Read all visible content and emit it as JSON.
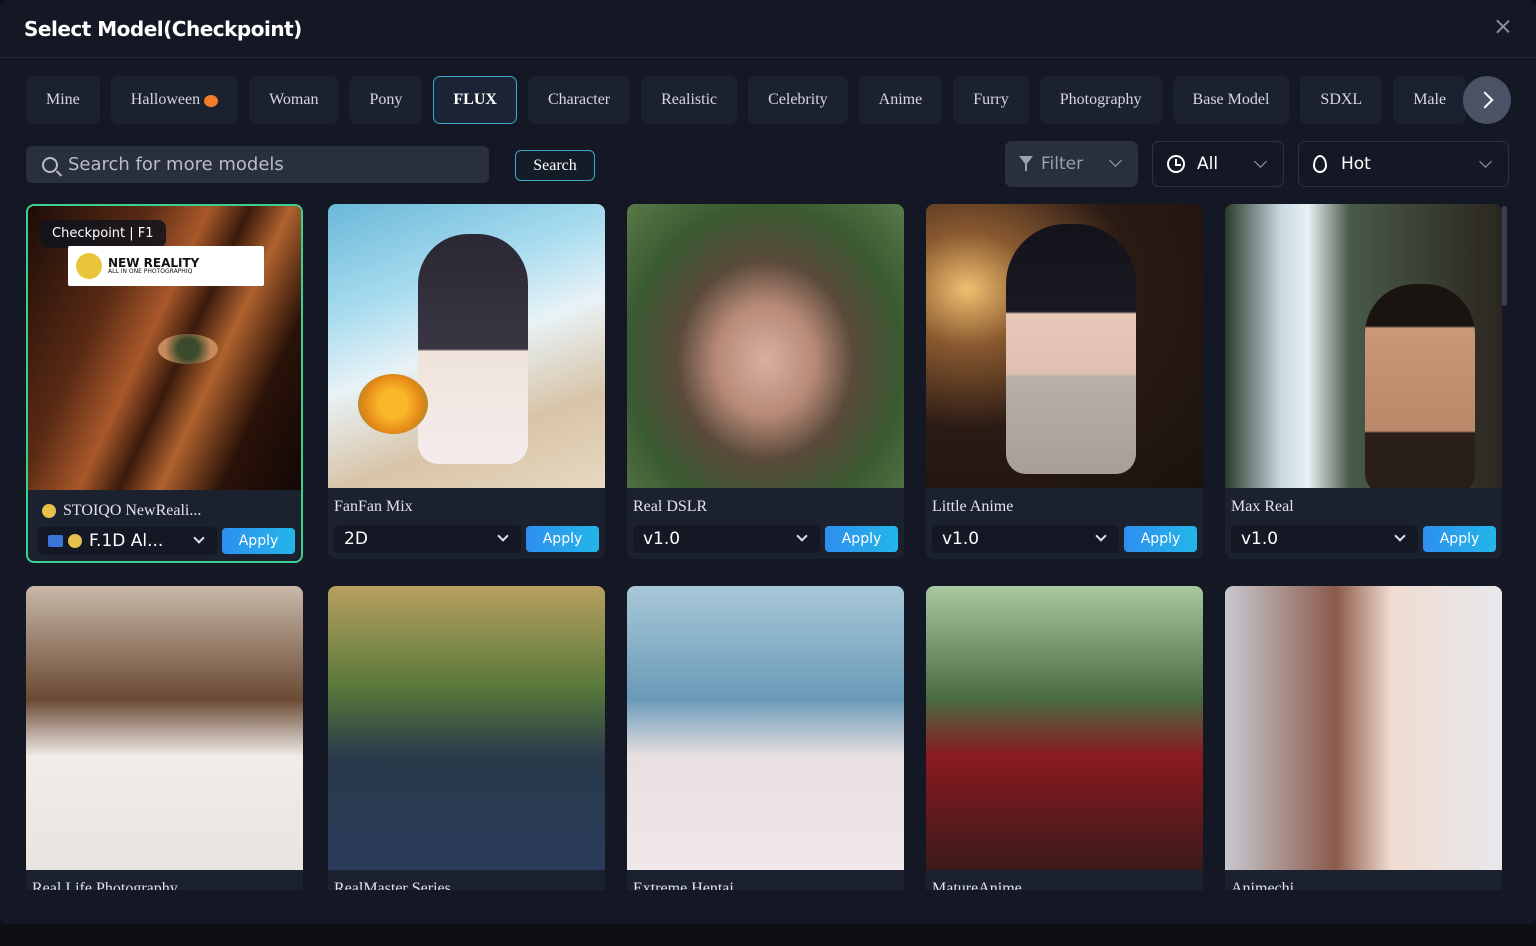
{
  "modal": {
    "title": "Select Model(Checkpoint)"
  },
  "tabs": [
    "Mine",
    "Halloween",
    "Woman",
    "Pony",
    "FLUX",
    "Character",
    "Realistic",
    "Celebrity",
    "Anime",
    "Furry",
    "Photography",
    "Base Model",
    "SDXL",
    "Male"
  ],
  "active_tab": "FLUX",
  "search": {
    "placeholder": "Search for more models",
    "button": "Search"
  },
  "filters": {
    "filter_label": "Filter",
    "time_label": "All",
    "sort_label": "Hot"
  },
  "cards_row1": [
    {
      "name": "STOIQO NewReali...",
      "version": "F.1D Al...",
      "apply": "Apply",
      "badge": "Checkpoint | F1",
      "logo_big": "NEW REALITY",
      "logo_small": "ALL IN ONE PHOTOGRAPHIQ",
      "logo_brand": "STOIQO"
    },
    {
      "name": "FanFan Mix",
      "version": "2D",
      "apply": "Apply"
    },
    {
      "name": "Real DSLR",
      "version": "v1.0",
      "apply": "Apply"
    },
    {
      "name": "Little Anime",
      "version": "v1.0",
      "apply": "Apply"
    },
    {
      "name": "Max Real",
      "version": "v1.0",
      "apply": "Apply"
    }
  ],
  "cards_row2": [
    {
      "name": "Real Life Photography"
    },
    {
      "name": "RealMaster Series"
    },
    {
      "name": "Extreme Hentai"
    },
    {
      "name": "MatureAnime"
    },
    {
      "name": "Animechi"
    }
  ],
  "colors": {
    "accent": "#3fa7c8",
    "selected_border": "#3ecf8e",
    "apply_start": "#2e8ff0",
    "apply_end": "#23b6e8"
  },
  "icons": [
    "close-icon",
    "chevron-right-icon",
    "search-icon",
    "filter-icon",
    "clock-icon",
    "flame-icon",
    "chevron-down-icon",
    "pumpkin-icon"
  ]
}
